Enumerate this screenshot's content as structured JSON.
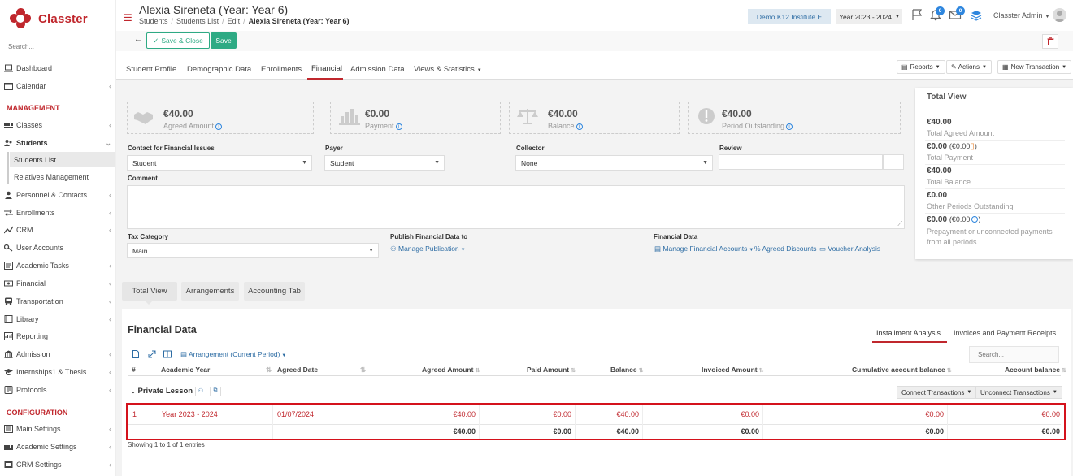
{
  "app": {
    "name": "Classter"
  },
  "sidebar": {
    "search_placeholder": "Search...",
    "items_top": [
      {
        "label": "Dashboard"
      },
      {
        "label": "Calendar"
      }
    ],
    "management_header": "MANAGEMENT",
    "classes": "Classes",
    "students": "Students",
    "students_sub": [
      "Students List",
      "Relatives Management"
    ],
    "items_mid": [
      "Personnel & Contacts",
      "Enrollments",
      "CRM",
      "User Accounts",
      "Academic Tasks",
      "Financial",
      "Transportation",
      "Library",
      "Reporting",
      "Admission",
      "Internships1 & Thesis",
      "Protocols"
    ],
    "configuration_header": "CONFIGURATION",
    "items_config": [
      "Main Settings",
      "Academic Settings",
      "CRM Settings"
    ]
  },
  "header": {
    "title": "Alexia Sireneta (Year: Year 6)",
    "breadcrumb": [
      "Students",
      "Students List",
      "Edit",
      "Alexia Sireneta (Year: Year 6)"
    ],
    "institute": "Demo K12 Institute E",
    "year": "Year 2023 - 2024",
    "notif_count": "0",
    "mail_count": "0",
    "user": "Classter Admin"
  },
  "actions": {
    "save_close": "Save & Close",
    "save": "Save"
  },
  "tabs": [
    "Student Profile",
    "Demographic Data",
    "Enrollments",
    "Financial",
    "Admission Data",
    "Views & Statistics"
  ],
  "tab_tools": {
    "reports": "Reports",
    "actions": "Actions",
    "new_transaction": "New Transaction"
  },
  "summary": [
    {
      "value": "€40.00",
      "label": "Agreed Amount"
    },
    {
      "value": "€0.00",
      "label": "Payment"
    },
    {
      "value": "€40.00",
      "label": "Balance"
    },
    {
      "value": "€40.00",
      "label": "Period Outstanding"
    }
  ],
  "form": {
    "contact_label": "Contact for Financial Issues",
    "contact_value": "Student",
    "payer_label": "Payer",
    "payer_value": "Student",
    "collector_label": "Collector",
    "collector_value": "None",
    "review_label": "Review",
    "comment_label": "Comment",
    "tax_label": "Tax Category",
    "tax_value": "Main",
    "publish_label": "Publish Financial Data to",
    "manage_publication": "Manage Publication",
    "fin_data_label": "Financial Data",
    "manage_accounts": "Manage Financial Accounts",
    "agreed_discounts": "Agreed Discounts",
    "voucher_analysis": "Voucher Analysis"
  },
  "total_view": {
    "title": "Total View",
    "rows": [
      {
        "value": "€40.00",
        "extra": "",
        "label": "Total Agreed Amount"
      },
      {
        "value": "€0.00",
        "extra": "(€0.00",
        "label": "Total Payment"
      },
      {
        "value": "€40.00",
        "extra": "",
        "label": "Total Balance"
      },
      {
        "value": "€0.00",
        "extra": "",
        "label": "Other Periods Outstanding"
      },
      {
        "value": "€0.00",
        "extra": "(€0.00",
        "label": "Prepayment or unconnected payments from all periods."
      }
    ]
  },
  "subtabs": [
    "Total View",
    "Arrangements",
    "Accounting Tab"
  ],
  "financial_data": {
    "title": "Financial Data",
    "tab_installment": "Installment Analysis",
    "tab_invoices": "Invoices and Payment Receipts",
    "search_placeholder": "Search...",
    "arrangement_dropdown": "Arrangement (Current Period)",
    "columns": [
      "#",
      "Academic Year",
      "Agreed Date",
      "Agreed Amount",
      "Paid Amount",
      "Balance",
      "Invoiced Amount",
      "Cumulative account balance",
      "Account balance"
    ],
    "group": "Private Lesson",
    "connect": "Connect Transactions",
    "unconnect": "Unconnect Transactions",
    "row": [
      "1",
      "Year 2023 - 2024",
      "01/07/2024",
      "€40.00",
      "€0.00",
      "€40.00",
      "€0.00",
      "€0.00",
      "€0.00"
    ],
    "totals": [
      "€40.00",
      "€0.00",
      "€40.00",
      "€0.00",
      "€0.00",
      "€0.00"
    ],
    "footer": "Showing 1 to 1 of 1 entries"
  },
  "colors": {
    "brand": "#c0272d",
    "accent": "#2eaa84",
    "link": "#2e6da4",
    "highlight_border": "#d4121c"
  }
}
